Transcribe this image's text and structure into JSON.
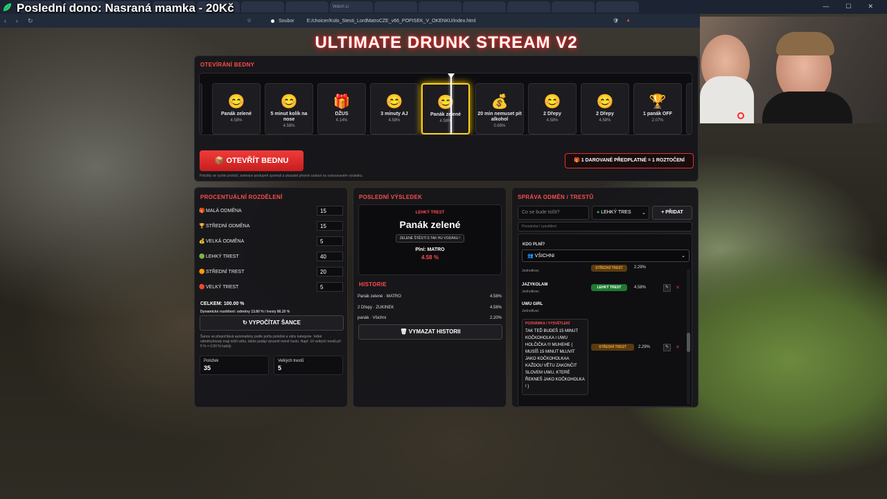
{
  "overlay": {
    "donor_banner": "Poslední dono: Nasraná mamka - 20Kč"
  },
  "browser": {
    "tabs": [
      "",
      "",
      "",
      "",
      "",
      "",
      "",
      "Watch Li",
      "",
      "",
      "",
      "",
      "",
      ""
    ],
    "url_label": "Soubor",
    "url": "E:/choicer/Kolo_Stesti_LordMatroCZE_v66_POPISEK_V_OKENKU/index.html"
  },
  "app": {
    "title": "ULTIMATE DRUNK STREAM V2"
  },
  "roulette": {
    "title": "OTEVÍRÁNÍ BEDNY",
    "items": [
      {
        "icon": "😊",
        "name": "Panák zelené",
        "percent": "4.58%"
      },
      {
        "icon": "😊",
        "name": "5 minut kolík na nose",
        "percent": "4.58%"
      },
      {
        "icon": "🎁",
        "name": "DŽUS",
        "percent": "4.14%"
      },
      {
        "icon": "😊",
        "name": "3 minuty AJ",
        "percent": "4.58%"
      },
      {
        "icon": "😊",
        "name": "Panák zelené",
        "percent": "4.58%"
      },
      {
        "icon": "💰",
        "name": "20 min nemuset pít alkohol",
        "percent": "0.69%"
      },
      {
        "icon": "😊",
        "name": "2 Dřepy",
        "percent": "4.58%"
      },
      {
        "icon": "😊",
        "name": "2 Dřepy",
        "percent": "4.58%"
      },
      {
        "icon": "🏆",
        "name": "1 panák OFF",
        "percent": "2.07%"
      }
    ],
    "open_button": "OTEVŘÍT BEDNU",
    "hint": "Položky se rychle protočí, animace postupně zpomalí a ukazatel přesně zastaví na vylosovaném výsledku.",
    "sub_badge": "1 DAROVANÉ PŘEDPLATNÉ = 1 ROZTOČENÍ"
  },
  "distribution": {
    "title": "PROCENTUÁLNÍ ROZDĚLENÍ",
    "rows": [
      {
        "icon": "🎁",
        "label": "MALÁ ODMĚNA",
        "value": "15"
      },
      {
        "icon": "🏆",
        "label": "STŘEDNÍ ODMĚNA",
        "value": "15"
      },
      {
        "icon": "💰",
        "label": "VELKÁ ODMĚNA",
        "value": "5"
      },
      {
        "icon": "🟢",
        "label": "LEHKÝ TREST",
        "value": "40"
      },
      {
        "icon": "🟠",
        "label": "STŘEDNÍ TREST",
        "value": "20"
      },
      {
        "icon": "🔴",
        "label": "VELKÝ TREST",
        "value": "5"
      }
    ],
    "total": "CELKEM: 100.00 %",
    "dynamic": "Dynamické rozdělení: odměny 13.80 % / tresty 86.20 %",
    "calc_button": "VYPOČÍTAT ŠANCE",
    "note": "Šance se přepočítává automaticky podle počtu položek a váhy kategorie. Velké odměny/tresty mají nižší váhu, takže padají výrazně méně často. Např. 10 velkých trestů při 5 % = 0.50 % každý.",
    "stats": [
      {
        "label": "Položek",
        "value": "35"
      },
      {
        "label": "Velkých trestů",
        "value": "5"
      }
    ]
  },
  "result": {
    "title": "POSLEDNÍ VÝSLEDEK",
    "category": "LEHKÝ TREST",
    "name": "Panák zelené",
    "tag": "ZELENÉ ŠTĚSTÍ S TAK HU VODÁKU !",
    "fulfills": "Plní: MATRO",
    "percent": "4.58 %",
    "history_title": "HISTORIE",
    "history": [
      {
        "text": "Panák zelené · MATRO",
        "pct": "4.58%"
      },
      {
        "text": "2 Dřepy · ZUKINEK",
        "pct": "4.58%"
      },
      {
        "text": "panák · Všichni",
        "pct": "2.20%"
      }
    ],
    "clear_button": "VYMAZAT HISTORII"
  },
  "manage": {
    "title": "SPRÁVA ODMĚN / TRESTŮ",
    "input_placeholder": "Co se bude točit?",
    "category_select": "LEHKÝ TRES",
    "add_button": "+ PŘIDAT",
    "note_placeholder": "Poznámka / vysvětlení",
    "who_label": "KDO PLNÍ?",
    "who_select": "VŠICHNI",
    "items": [
      {
        "name": "",
        "who": "Jednotlivec",
        "badge": "STŘEDNÍ TREST",
        "pct": "2.29%"
      },
      {
        "name": "JAZYKOLAM",
        "who": "Jednotlivec",
        "badge": "LEHKÝ TREST",
        "pct": "4.58%"
      },
      {
        "name": "UWU GIRL",
        "who": "Jednotlivec",
        "badge": "STŘEDNÍ TREST",
        "pct": "2.29%"
      }
    ],
    "note_title": "POZNÁMKA / VYSVĚTLENÍ",
    "note_text": "TAK TEĎ BUDEŠ 15 MINUT KOČKOHOLKA I UWU HOLČIČKA !!! MUHEHE ( MUSÍŠ 15 MINUT MLUVIT JAKO KOČKOHOLKAA KAŽDOU VĚTU ZAKONČIT SLOVEM UWU, KTERÉ ŘEKNEŠ JAKO KOČKOHOLKA ! )"
  },
  "colors": {
    "accent": "#ff4d4d",
    "gold": "#ffd21a",
    "light": "#2db84d",
    "medium": "#d18a1a"
  }
}
